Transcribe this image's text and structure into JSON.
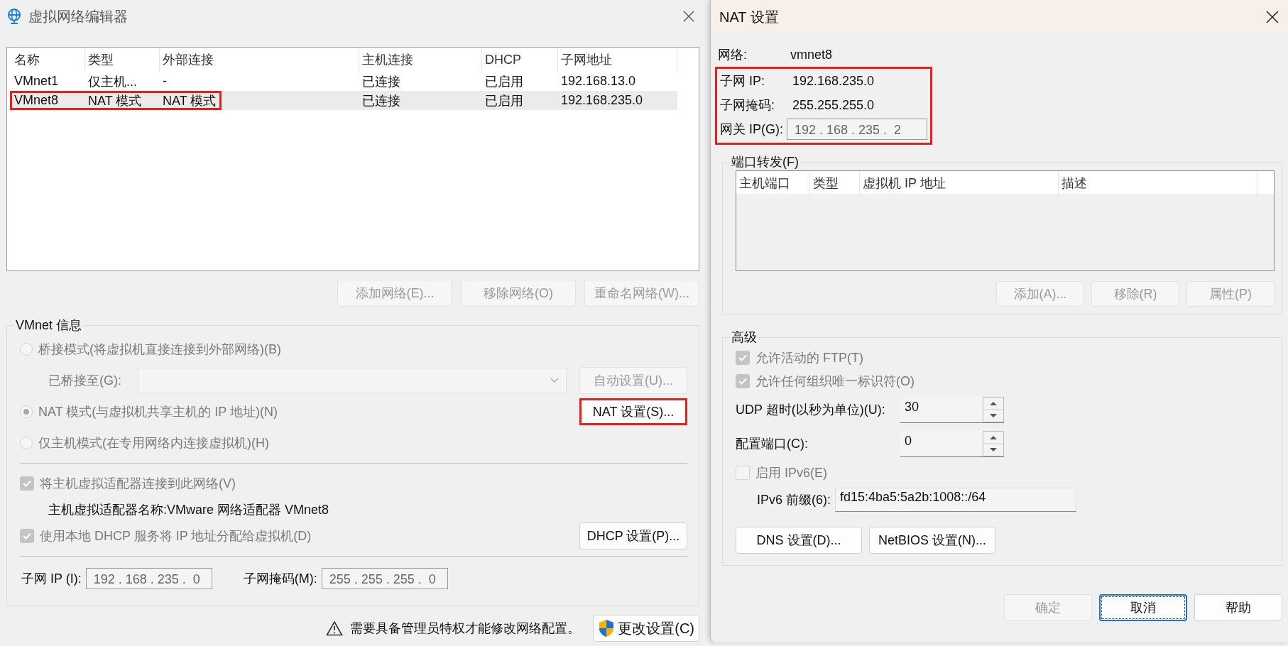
{
  "editor": {
    "title": "虚拟网络编辑器",
    "table": {
      "columns": [
        "名称",
        "类型",
        "外部连接",
        "主机连接",
        "DHCP",
        "子网地址"
      ],
      "rows": [
        {
          "cells": [
            "VMnet1",
            "仅主机...",
            "-",
            "已连接",
            "已启用",
            "192.168.13.0"
          ],
          "selected": false,
          "highlighted": false
        },
        {
          "cells": [
            "VMnet8",
            "NAT 模式",
            "NAT 模式",
            "已连接",
            "已启用",
            "192.168.235.0"
          ],
          "selected": true,
          "highlighted": true
        }
      ]
    },
    "network_buttons": [
      {
        "label": "添加网络(E)...",
        "disabled": true
      },
      {
        "label": "移除网络(O)",
        "disabled": true
      },
      {
        "label": "重命名网络(W)...",
        "disabled": true
      }
    ],
    "info": {
      "title": "VMnet 信息",
      "modes": [
        {
          "label": "桥接模式(将虚拟机直接连接到外部网络)(B)",
          "selected": false,
          "disabled": true
        },
        {
          "label": "NAT 模式(与虚拟机共享主机的 IP 地址)(N)",
          "selected": true,
          "disabled": true
        },
        {
          "label": "仅主机模式(在专用网络内连接虚拟机)(H)",
          "selected": false,
          "disabled": true
        }
      ],
      "bridged_label": "已桥接至(G):",
      "auto_button": {
        "label": "自动设置(U)...",
        "disabled": true
      },
      "nat_button": {
        "label": "NAT 设置(S)...",
        "highlighted": true
      },
      "connect_adapter": {
        "label": "将主机虚拟适配器连接到此网络(V)",
        "checked": true,
        "disabled": true
      },
      "adapter_name": {
        "label": "主机虚拟适配器名称:",
        "value": "VMware 网络适配器 VMnet8"
      },
      "use_dhcp": {
        "label": "使用本地 DHCP 服务将 IP 地址分配给虚拟机(D)",
        "checked": true,
        "disabled": true
      },
      "dhcp_button": {
        "label": "DHCP 设置(P)...",
        "disabled": false
      },
      "subnet_ip": {
        "label": "子网 IP (I):",
        "value": "192 . 168 . 235 .  0"
      },
      "subnet_mask": {
        "label": "子网掩码(M):",
        "value": "255 . 255 . 255 .  0"
      }
    },
    "warning": "需要具备管理员特权才能修改网络配置。",
    "change_button": "更改设置(C)"
  },
  "nat": {
    "title": "NAT 设置",
    "network": {
      "label": "网络:",
      "value": "vmnet8"
    },
    "addressing": {
      "highlighted": true,
      "subnet_ip": {
        "label": "子网 IP:",
        "value": "192.168.235.0"
      },
      "subnet_mask": {
        "label": "子网掩码:",
        "value": "255.255.255.0"
      },
      "gateway": {
        "label": "网关 IP(G):",
        "value": "192 . 168 . 235 .  2"
      }
    },
    "port_forwarding": {
      "title": "端口转发(F)",
      "columns": [
        "主机端口",
        "类型",
        "虚拟机 IP 地址",
        "描述"
      ],
      "buttons": [
        {
          "label": "添加(A)...",
          "disabled": true
        },
        {
          "label": "移除(R)",
          "disabled": true
        },
        {
          "label": "属性(P)",
          "disabled": true
        }
      ]
    },
    "advanced": {
      "title": "高级",
      "checkboxes": [
        {
          "label": "允许活动的 FTP(T)",
          "checked": true,
          "disabled": true
        },
        {
          "label": "允许任何组织唯一标识符(O)",
          "checked": true,
          "disabled": true
        }
      ],
      "spinners": [
        {
          "label": "UDP 超时(以秒为单位)(U):",
          "value": "30"
        },
        {
          "label": "配置端口(C):",
          "value": "0"
        }
      ],
      "ipv6": {
        "label": "启用 IPv6(E)",
        "checked": false,
        "disabled": true
      },
      "ipv6_prefix": {
        "label": "IPv6 前缀(6):",
        "value": "fd15:4ba5:5a2b:1008::/64"
      },
      "buttons": [
        {
          "label": "DNS 设置(D)..."
        },
        {
          "label": "NetBIOS 设置(N)..."
        }
      ]
    },
    "dialog_buttons": [
      {
        "label": "确定",
        "disabled": true,
        "default": false
      },
      {
        "label": "取消",
        "disabled": false,
        "default": true
      },
      {
        "label": "帮助",
        "disabled": false,
        "default": false
      }
    ]
  }
}
